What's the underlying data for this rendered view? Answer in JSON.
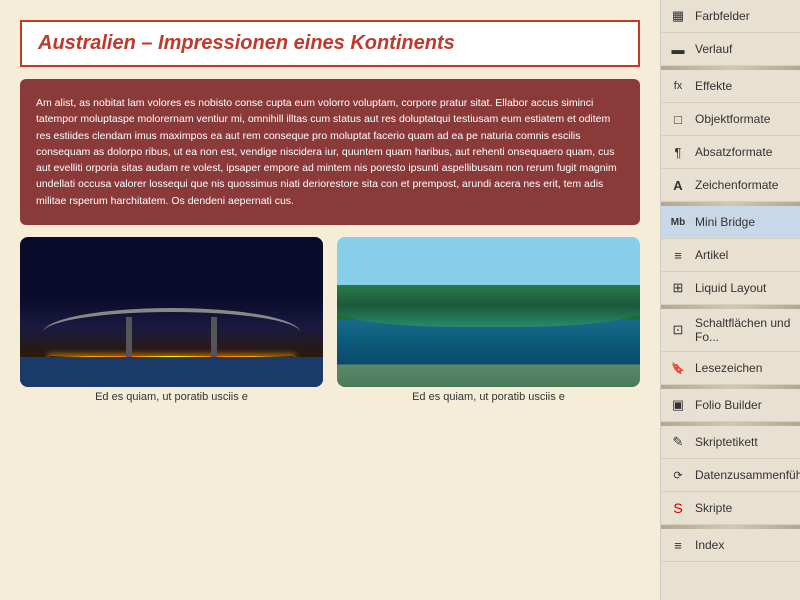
{
  "page": {
    "title": "Australien – Impressionen eines Kontinents",
    "body_text": "Am alist, as nobitat lam volores es nobisto conse cupta eum volorro voluptam, corpore pratur sitat. Ellabor accus siminci tatempor moluptaspe molorernam ventiur mi, omnihill illtas cum status aut res doluptatqui testiusam eum estiatem et oditem res estiides clendam imus maximpos ea aut rem conseque pro moluptat facerio quam ad ea pe naturia comnis escilis consequam as dolor­po ribus, ut ea non est, vendige niscidera iur, quuntem quam haribus, aut rehenti onsequaero quam, cus aut evelliti orporia sitas audam re volest, ipsaper empore ad mintem nis poresto ipsunti aspellibusam non rerum fugit magnim undellati occusa valorer lossequi que nis quossimus niati deriorestore sita con et prempost, arundi acera nes erit, tem adis militae rsperum harchitatem. Os dendeni aepernati cus.",
    "image1_caption": "Ed es quiam, ut poratib usciis e",
    "image2_caption": "Ed es quiam, ut poratib usciis e"
  },
  "sidebar": {
    "items": [
      {
        "id": "farbfelder",
        "icon": "▦",
        "label": "Farbfelder"
      },
      {
        "id": "verlauf",
        "icon": "▬",
        "label": "Verlauf"
      },
      {
        "id": "effekte",
        "icon": "ƒ×",
        "label": "Effekte"
      },
      {
        "id": "objektformate",
        "icon": "□",
        "label": "Objektformate"
      },
      {
        "id": "absatzformate",
        "icon": "¶",
        "label": "Absatzformate"
      },
      {
        "id": "zeichenformate",
        "icon": "A",
        "label": "Zeichenformate"
      },
      {
        "id": "mini-bridge",
        "icon": "Mb",
        "label": "Mini Bridge"
      },
      {
        "id": "artikel",
        "icon": "≡",
        "label": "Artikel"
      },
      {
        "id": "liquid-layout",
        "icon": "⊞",
        "label": "Liquid Layout"
      },
      {
        "id": "schaltflachen",
        "icon": "⊡",
        "label": "Schaltflächen und Fo..."
      },
      {
        "id": "lesezeichen",
        "icon": "🔖",
        "label": "Lesezeichen"
      },
      {
        "id": "folio-builder",
        "icon": "▣",
        "label": "Folio Builder"
      },
      {
        "id": "skriptetikett",
        "icon": "✎",
        "label": "Skriptetikett"
      },
      {
        "id": "datenzusammenfuhr",
        "icon": "⟳",
        "label": "Datenzusammenführ..."
      },
      {
        "id": "skripte",
        "icon": "S",
        "label": "Skripte"
      },
      {
        "id": "index",
        "icon": "≡",
        "label": "Index"
      }
    ]
  }
}
